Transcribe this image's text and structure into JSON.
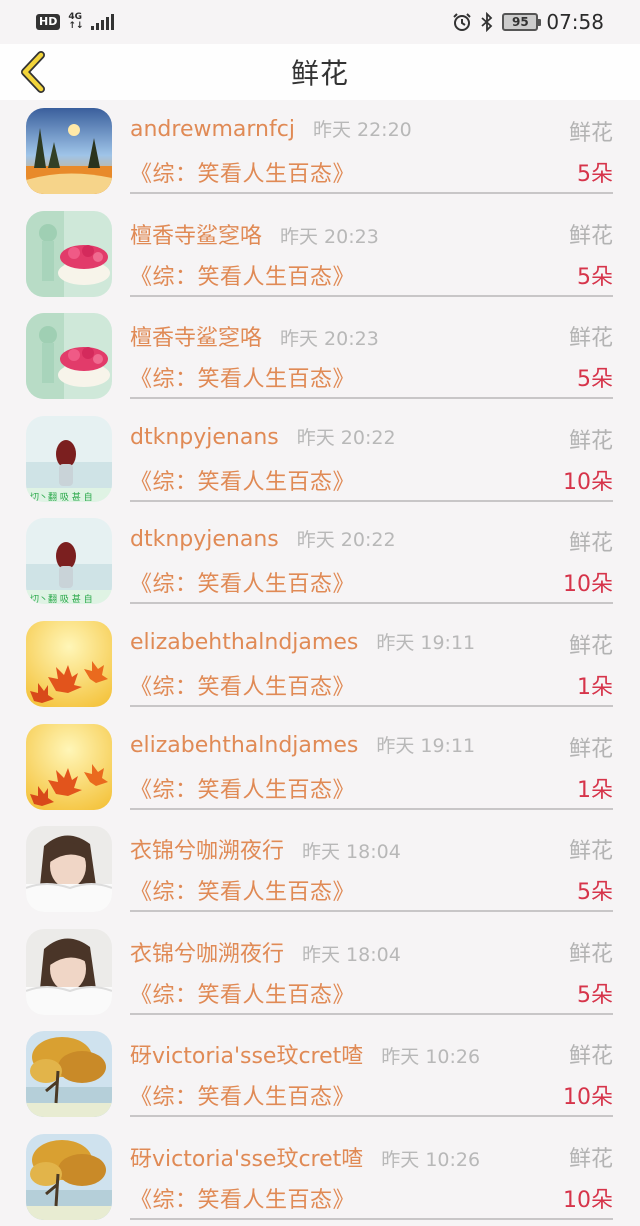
{
  "status_bar": {
    "hd": "HD",
    "network_top": "4G",
    "network_bottom": "↑↓",
    "battery": "95",
    "time": "07:58"
  },
  "header": {
    "title": "鲜花",
    "back_icon": "chevron-left-icon"
  },
  "colors": {
    "accent": "#e08a55",
    "amount": "#d6344a",
    "muted": "#b3b3b3"
  },
  "records": [
    {
      "user": "andrewmarnfcj",
      "time": "昨天 22:20",
      "gift": "鲜花",
      "book": "《综：笑看人生百态》",
      "amount": "5朵",
      "avatar": "sunset-landscape"
    },
    {
      "user": "檀香寺鲨窆咯",
      "time": "昨天 20:23",
      "gift": "鲜花",
      "book": "《综：笑看人生百态》",
      "amount": "5朵",
      "avatar": "flower-bowl"
    },
    {
      "user": "檀香寺鲨窆咯",
      "time": "昨天 20:23",
      "gift": "鲜花",
      "book": "《综：笑看人生百态》",
      "amount": "5朵",
      "avatar": "flower-bowl"
    },
    {
      "user": "dtknpyjenans",
      "time": "昨天 20:22",
      "gift": "鲜花",
      "book": "《综：笑看人生百态》",
      "amount": "10朵",
      "avatar": "girl-seaside"
    },
    {
      "user": "dtknpyjenans",
      "time": "昨天 20:22",
      "gift": "鲜花",
      "book": "《综：笑看人生百态》",
      "amount": "10朵",
      "avatar": "girl-seaside"
    },
    {
      "user": "elizabehthalndjames",
      "time": "昨天 19:11",
      "gift": "鲜花",
      "book": "《综：笑看人生百态》",
      "amount": "1朵",
      "avatar": "maple-leaves"
    },
    {
      "user": "elizabehthalndjames",
      "time": "昨天 19:11",
      "gift": "鲜花",
      "book": "《综：笑看人生百态》",
      "amount": "1朵",
      "avatar": "maple-leaves"
    },
    {
      "user": "衣锦兮咖溯夜行",
      "time": "昨天 18:04",
      "gift": "鲜花",
      "book": "《综：笑看人生百态》",
      "amount": "5朵",
      "avatar": "girl-portrait"
    },
    {
      "user": "衣锦兮咖溯夜行",
      "time": "昨天 18:04",
      "gift": "鲜花",
      "book": "《综：笑看人生百态》",
      "amount": "5朵",
      "avatar": "girl-portrait"
    },
    {
      "user": "砑victoria'sse玟cret喳",
      "time": "昨天 10:26",
      "gift": "鲜花",
      "book": "《综：笑看人生百态》",
      "amount": "10朵",
      "avatar": "autumn-tree"
    },
    {
      "user": "砑victoria'sse玟cret喳",
      "time": "昨天 10:26",
      "gift": "鲜花",
      "book": "《综：笑看人生百态》",
      "amount": "10朵",
      "avatar": "autumn-tree"
    }
  ]
}
